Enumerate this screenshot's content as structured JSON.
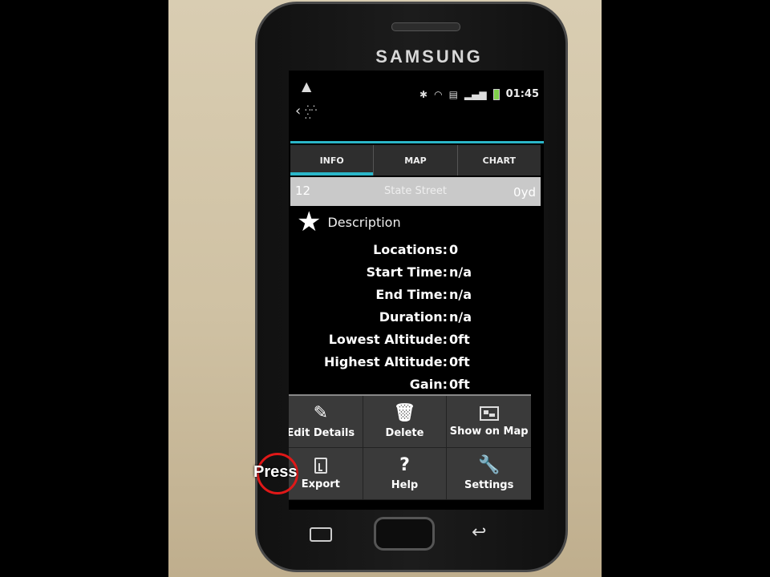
{
  "device": {
    "brand": "SAMSUNG"
  },
  "status_bar": {
    "time": "01:45"
  },
  "tabs": [
    {
      "label": "INFO",
      "active": true
    },
    {
      "label": "MAP",
      "active": false
    },
    {
      "label": "CHART",
      "active": false
    }
  ],
  "track": {
    "number": "12",
    "name": "State Street",
    "distance": "0yd"
  },
  "description_label": "Description",
  "stats": [
    {
      "label": "Locations:",
      "value": "0"
    },
    {
      "label": "Start Time:",
      "value": "n/a"
    },
    {
      "label": "End Time:",
      "value": "n/a"
    },
    {
      "label": "Duration:",
      "value": "n/a"
    },
    {
      "label": "Lowest Altitude:",
      "value": "0ft"
    },
    {
      "label": "Highest Altitude:",
      "value": "0ft"
    },
    {
      "label": "Gain:",
      "value": "0ft"
    }
  ],
  "menu": {
    "edit_details": "Edit Details",
    "delete": "Delete",
    "show_on_map": "Show on Map",
    "export": "Export",
    "help": "Help",
    "settings": "Settings"
  },
  "annotation": {
    "press_label": "Press"
  },
  "colors": {
    "accent": "#2ab6c8",
    "annotation_circle": "#e01818"
  }
}
